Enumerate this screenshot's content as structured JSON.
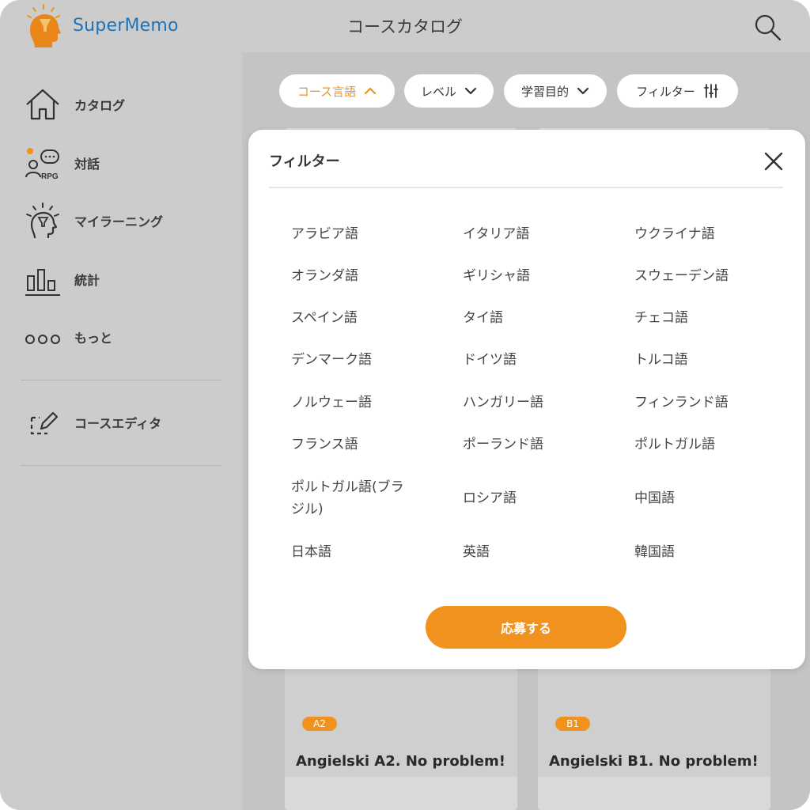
{
  "app": {
    "name": "SuperMemo",
    "page_title": "コースカタログ"
  },
  "colors": {
    "accent": "#f0921d",
    "brand_blue": "#1e73b8",
    "overlay_gray": "#cccccc"
  },
  "icons": {
    "search": "search-icon",
    "close": "close-icon",
    "home": "home-icon",
    "dialog": "chat-rpg-icon",
    "learning": "lightbulb-head-icon",
    "stats": "bar-chart-icon",
    "more": "more-dots-icon",
    "editor": "edit-icon"
  },
  "sidebar": {
    "items": [
      {
        "label": "カタログ"
      },
      {
        "label": "対話",
        "icon_text": "RPG"
      },
      {
        "label": "マイラーニング"
      },
      {
        "label": "統計"
      },
      {
        "label": "もっと"
      },
      {
        "label": "コースエディタ"
      }
    ]
  },
  "filters": {
    "chips": [
      {
        "label": "コース言語",
        "active": true
      },
      {
        "label": "レベル"
      },
      {
        "label": "学習目的"
      },
      {
        "label": "フィルター"
      }
    ]
  },
  "modal": {
    "title": "フィルター",
    "languages": [
      "アラビア語",
      "イタリア語",
      "ウクライナ語",
      "オランダ語",
      "ギリシャ語",
      "スウェーデン語",
      "スペイン語",
      "タイ語",
      "チェコ語",
      "デンマーク語",
      "ドイツ語",
      "トルコ語",
      "ノルウェー語",
      "ハンガリー語",
      "フィンランド語",
      "フランス語",
      "ポーランド語",
      "ポルトガル語",
      "ポルトガル語(ブラジル)",
      "ロシア語",
      "中国語",
      "日本語",
      "英語",
      "韓国語"
    ],
    "apply_label": "応募する"
  },
  "cards": [
    {
      "title": "Angielski A2. No problem!",
      "level": "A2"
    },
    {
      "title": "Angielski B1. No problem!",
      "level": "B1"
    }
  ]
}
